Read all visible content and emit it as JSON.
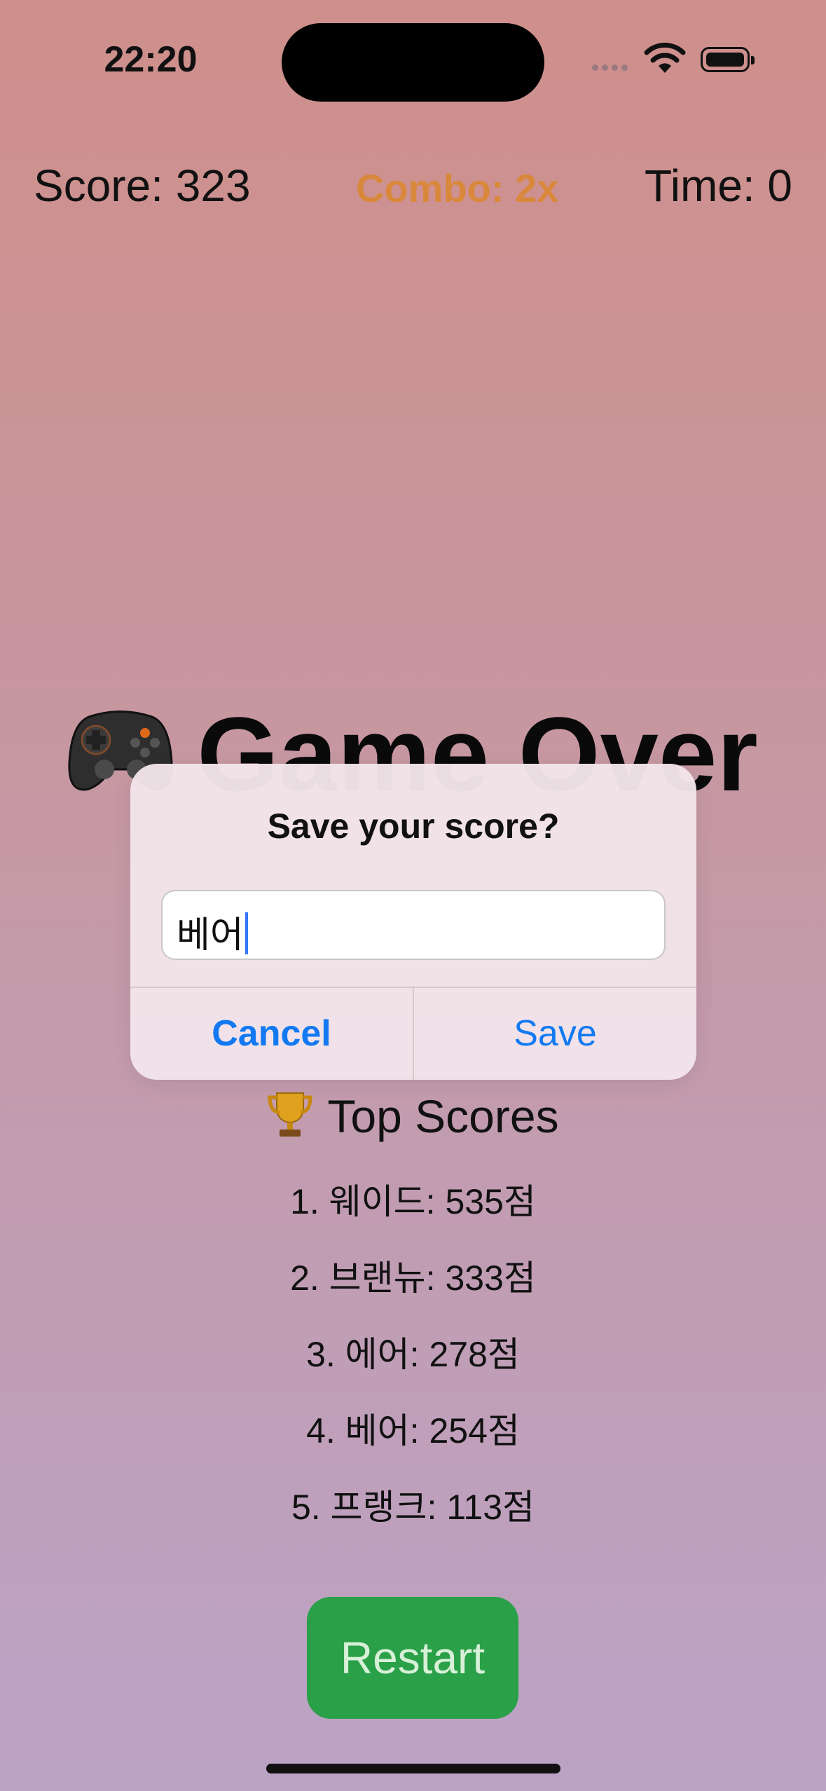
{
  "status": {
    "time": "22:20"
  },
  "hud": {
    "score": "Score: 323",
    "combo": "Combo: 2x",
    "time": "Time: 0"
  },
  "game_over": {
    "title": "Game Over"
  },
  "dialog": {
    "title": "Save your score?",
    "input_value": "베어",
    "cancel_label": "Cancel",
    "save_label": "Save"
  },
  "top_scores": {
    "title": "Top Scores",
    "items": [
      "1. 웨이드: 535점",
      "2. 브랜뉴: 333점",
      "3. 에어: 278점",
      "4. 베어: 254점",
      "5. 프랭크: 113점"
    ]
  },
  "restart_label": "Restart",
  "colors": {
    "combo": "#d9883b",
    "button_blue": "#1279f2",
    "restart_green": "#2aa048"
  }
}
